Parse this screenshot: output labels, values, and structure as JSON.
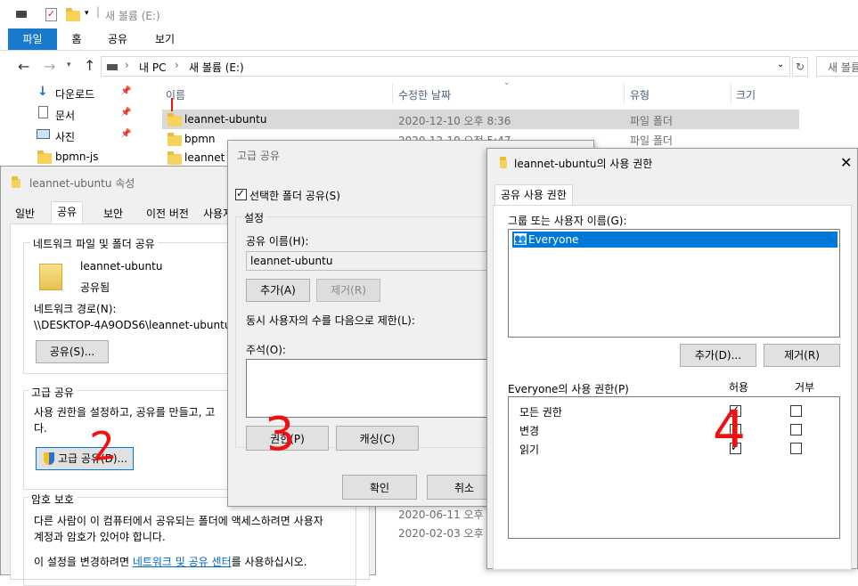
{
  "explorer": {
    "title": "새 볼륨 (E:)",
    "ribbon_tabs": [
      "파일",
      "홈",
      "공유",
      "보기"
    ],
    "address": [
      "내 PC",
      "새 볼륨 (E:)"
    ],
    "search_placeholder": "새 볼륨",
    "quick_access": [
      {
        "label": "다운로드",
        "icon": "download-icon"
      },
      {
        "label": "문서",
        "icon": "document-icon"
      },
      {
        "label": "사진",
        "icon": "picture-icon"
      },
      {
        "label": "bpmn-js",
        "icon": "folder-icon"
      }
    ],
    "columns": [
      "이름",
      "수정한 날짜",
      "유형",
      "크기"
    ],
    "files": [
      {
        "name": "leannet-ubuntu",
        "date": "2020-12-10 오후 8:36",
        "type": "파일 폴더"
      },
      {
        "name": "bpmn",
        "date": "2020-12-10 오전 5:47",
        "type": "파일 폴더"
      },
      {
        "name": "leannet",
        "date": "",
        "type": ""
      }
    ],
    "bottom_dates": [
      "2020-06-11 오후",
      "2020-02-03 오후"
    ]
  },
  "properties": {
    "title": "leannet-ubuntu 속성",
    "tabs": [
      "일반",
      "공유",
      "보안",
      "이전 버전",
      "사용자"
    ],
    "group_net": "네트워크 파일 및 폴더 공유",
    "folder_name": "leannet-ubuntu",
    "share_state": "공유됨",
    "path_label": "네트워크 경로(N):",
    "path_value": "\\\\DESKTOP-4A9ODS6\\leannet-ubuntu",
    "share_btn": "공유(S)...",
    "group_adv": "고급 공유",
    "adv_desc1": "사용 권한을 설정하고, 공유를 만들고, 고",
    "adv_desc2": "다.",
    "adv_btn": "고급 공유(D)...",
    "group_pw": "암호 보호",
    "pw_desc1": "다른 사람이 이 컴퓨터에서 공유되는 폴더에 액세스하려면 사용자",
    "pw_desc2": "계정과 암호가 있어야 합니다.",
    "pw_desc3": "이 설정을 변경하려면 ",
    "pw_link": "네트워크 및 공유 센터",
    "pw_desc4": "를 사용하십시오."
  },
  "advanced": {
    "title": "고급 공유",
    "share_checkbox": "선택한 폴더 공유(S)",
    "settings_label": "설정",
    "share_name_label": "공유 이름(H):",
    "share_name_value": "leannet-ubuntu",
    "add_btn": "추가(A)",
    "remove_btn": "제거(R)",
    "limit_label": "동시 사용자의 수를 다음으로 제한(L):",
    "comment_label": "주석(O):",
    "perm_btn": "권한(P)",
    "cache_btn": "캐싱(C)",
    "ok_btn": "확인",
    "cancel_btn": "취소"
  },
  "permissions": {
    "title": "leannet-ubuntu의 사용 권한",
    "tab": "공유 사용 권한",
    "group_label": "그룹 또는 사용자 이름(G):",
    "user": "Everyone",
    "add_btn": "추가(D)...",
    "remove_btn": "제거(R)",
    "perm_label": "Everyone의 사용 권한(P)",
    "allow": "허용",
    "deny": "거부",
    "rows": [
      {
        "label": "모든 권한",
        "allow": true,
        "deny": false
      },
      {
        "label": "변경",
        "allow": true,
        "deny": false
      },
      {
        "label": "읽기",
        "allow": true,
        "deny": false
      }
    ]
  },
  "annotations": [
    "2",
    "3",
    "4"
  ]
}
